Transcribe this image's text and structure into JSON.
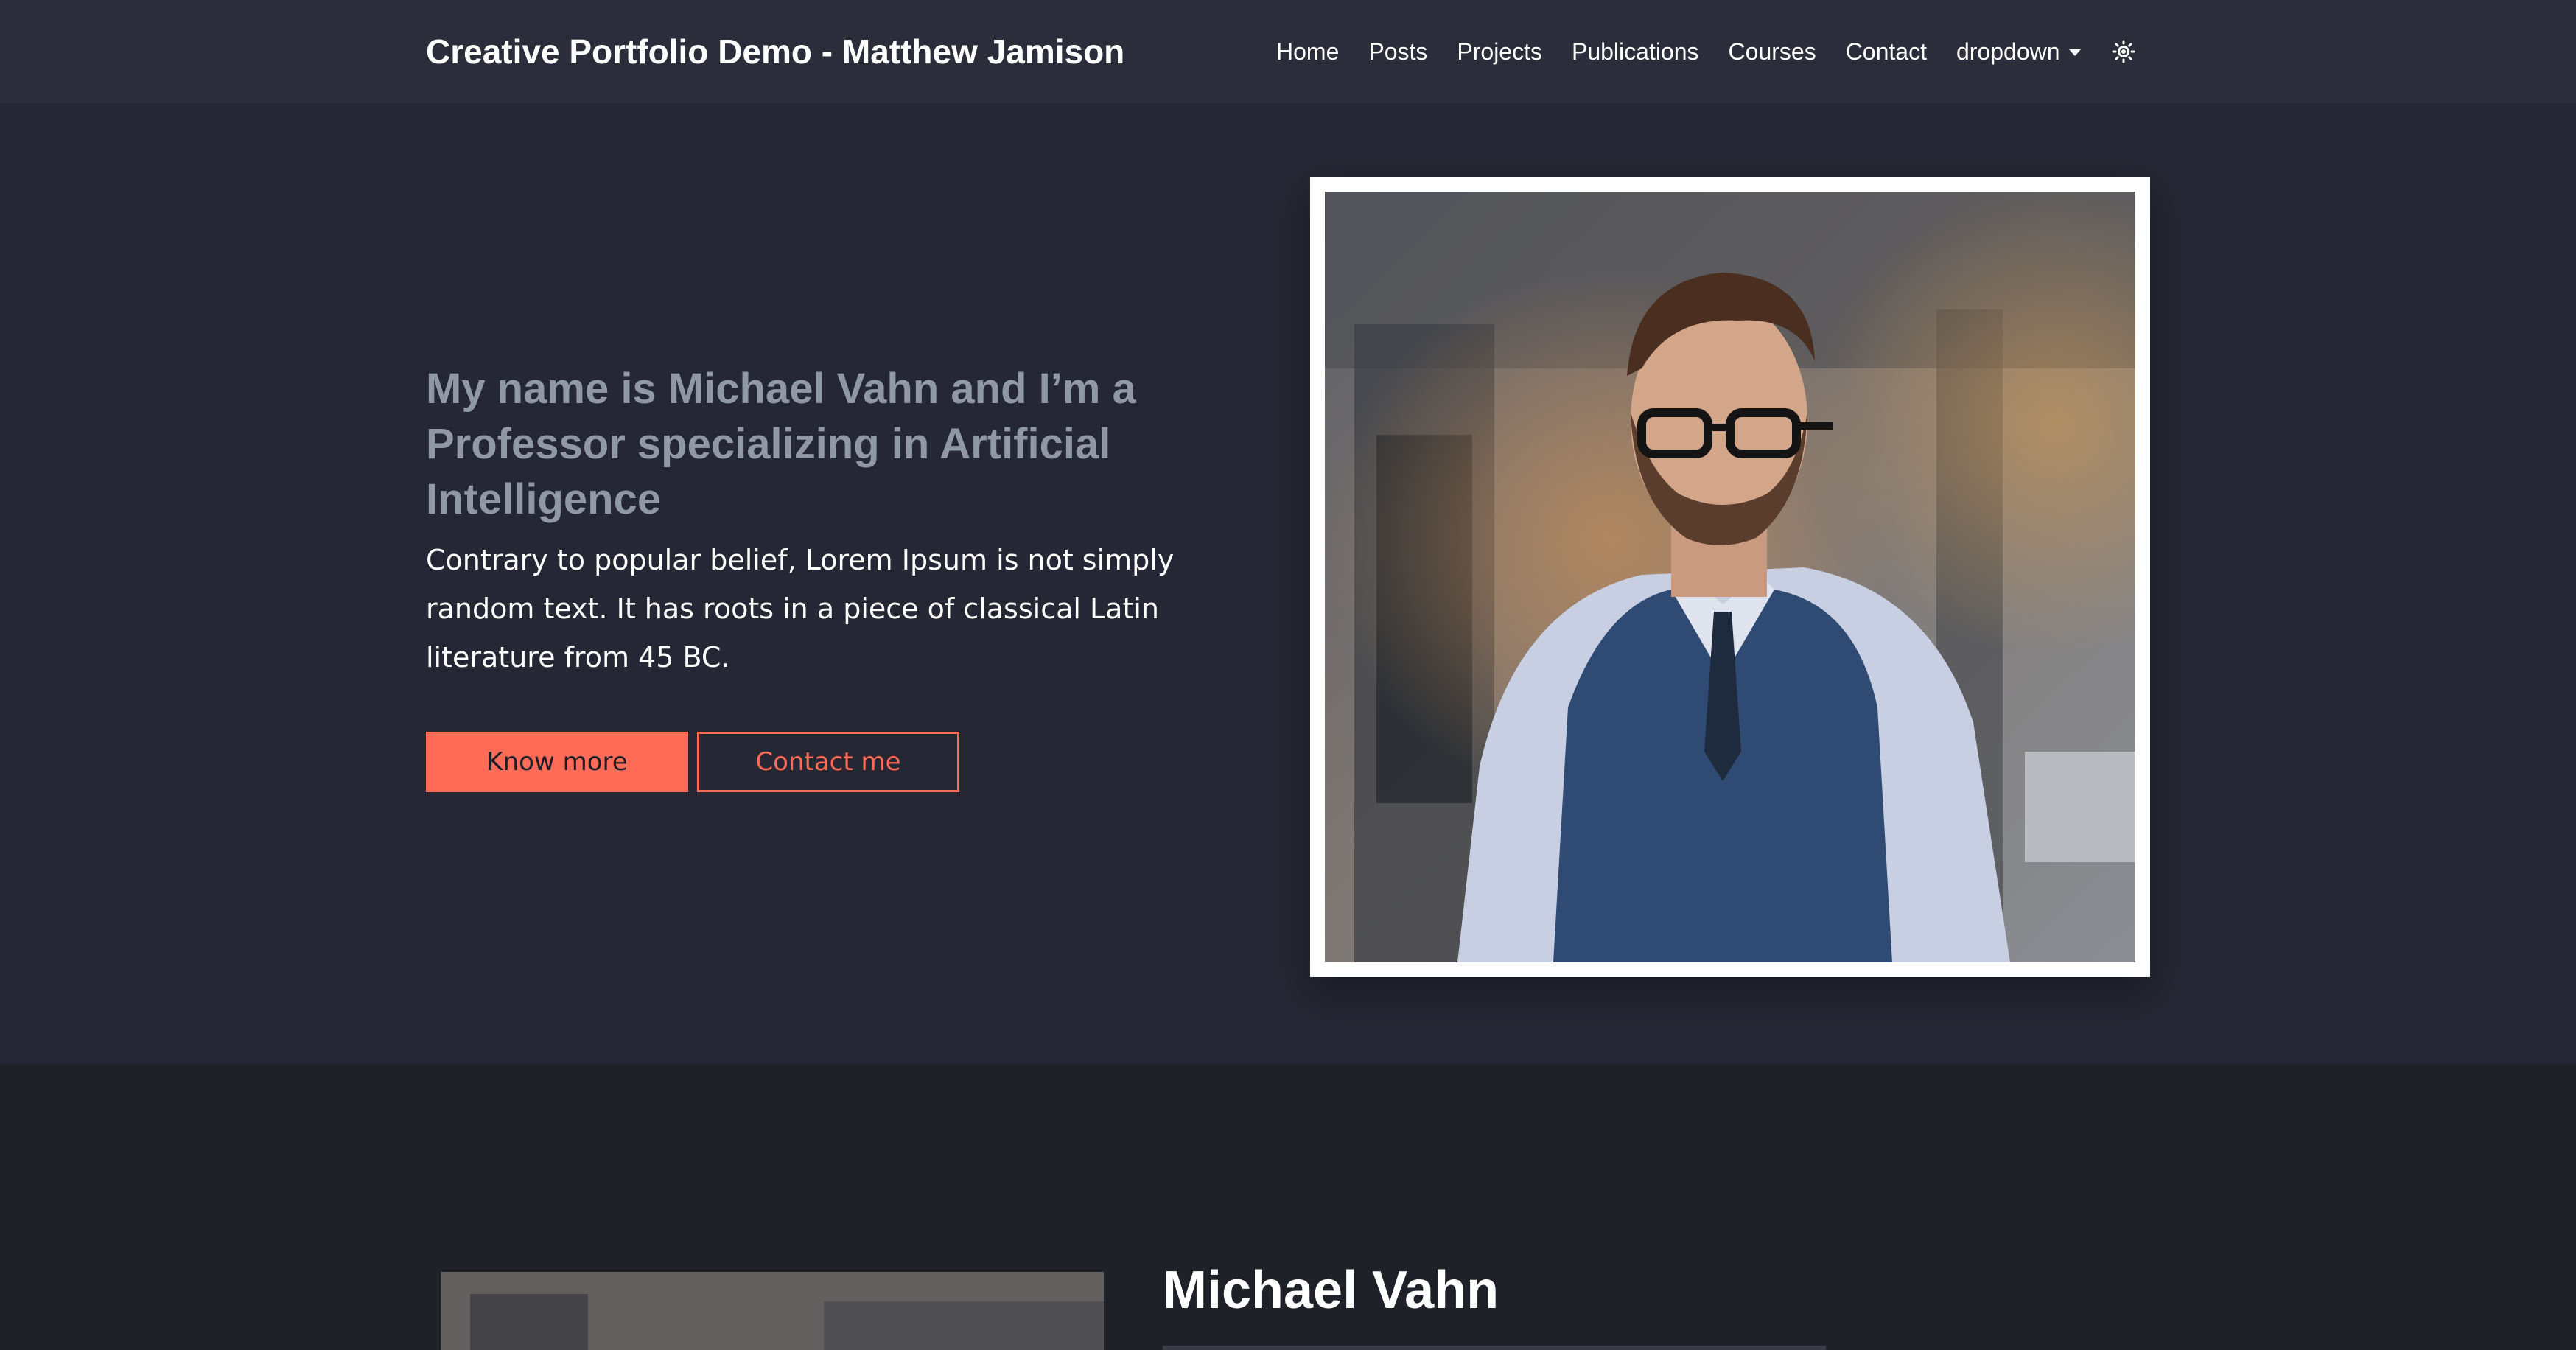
{
  "navbar": {
    "brand": "Creative Portfolio Demo - Matthew Jamison",
    "links": [
      "Home",
      "Posts",
      "Projects",
      "Publications",
      "Courses",
      "Contact"
    ],
    "dropdown_label": "dropdown",
    "theme_icon": "sun-icon"
  },
  "hero": {
    "heading_parts": {
      "p1": "My name is ",
      "name": "Michael Vahn",
      "p2": " and I’m a ",
      "role": "Professor",
      "p3": " specializing in ",
      "field": "Artificial Intelligence"
    },
    "description": "Contrary to popular belief, Lorem Ipsum is not simply random text. It has roots in a piece of classical Latin literature from 45 BC.",
    "primary_button": "Know more",
    "secondary_button": "Contact me",
    "photo_icon": "portrait-photo"
  },
  "about": {
    "name": "Michael Vahn"
  },
  "colors": {
    "background": "#252834",
    "navbar": "#2b2e3a",
    "section_alt": "#1f2129",
    "accent": "#ff6b57",
    "heading_muted": "#8f98a3",
    "text": "#ffffff"
  }
}
